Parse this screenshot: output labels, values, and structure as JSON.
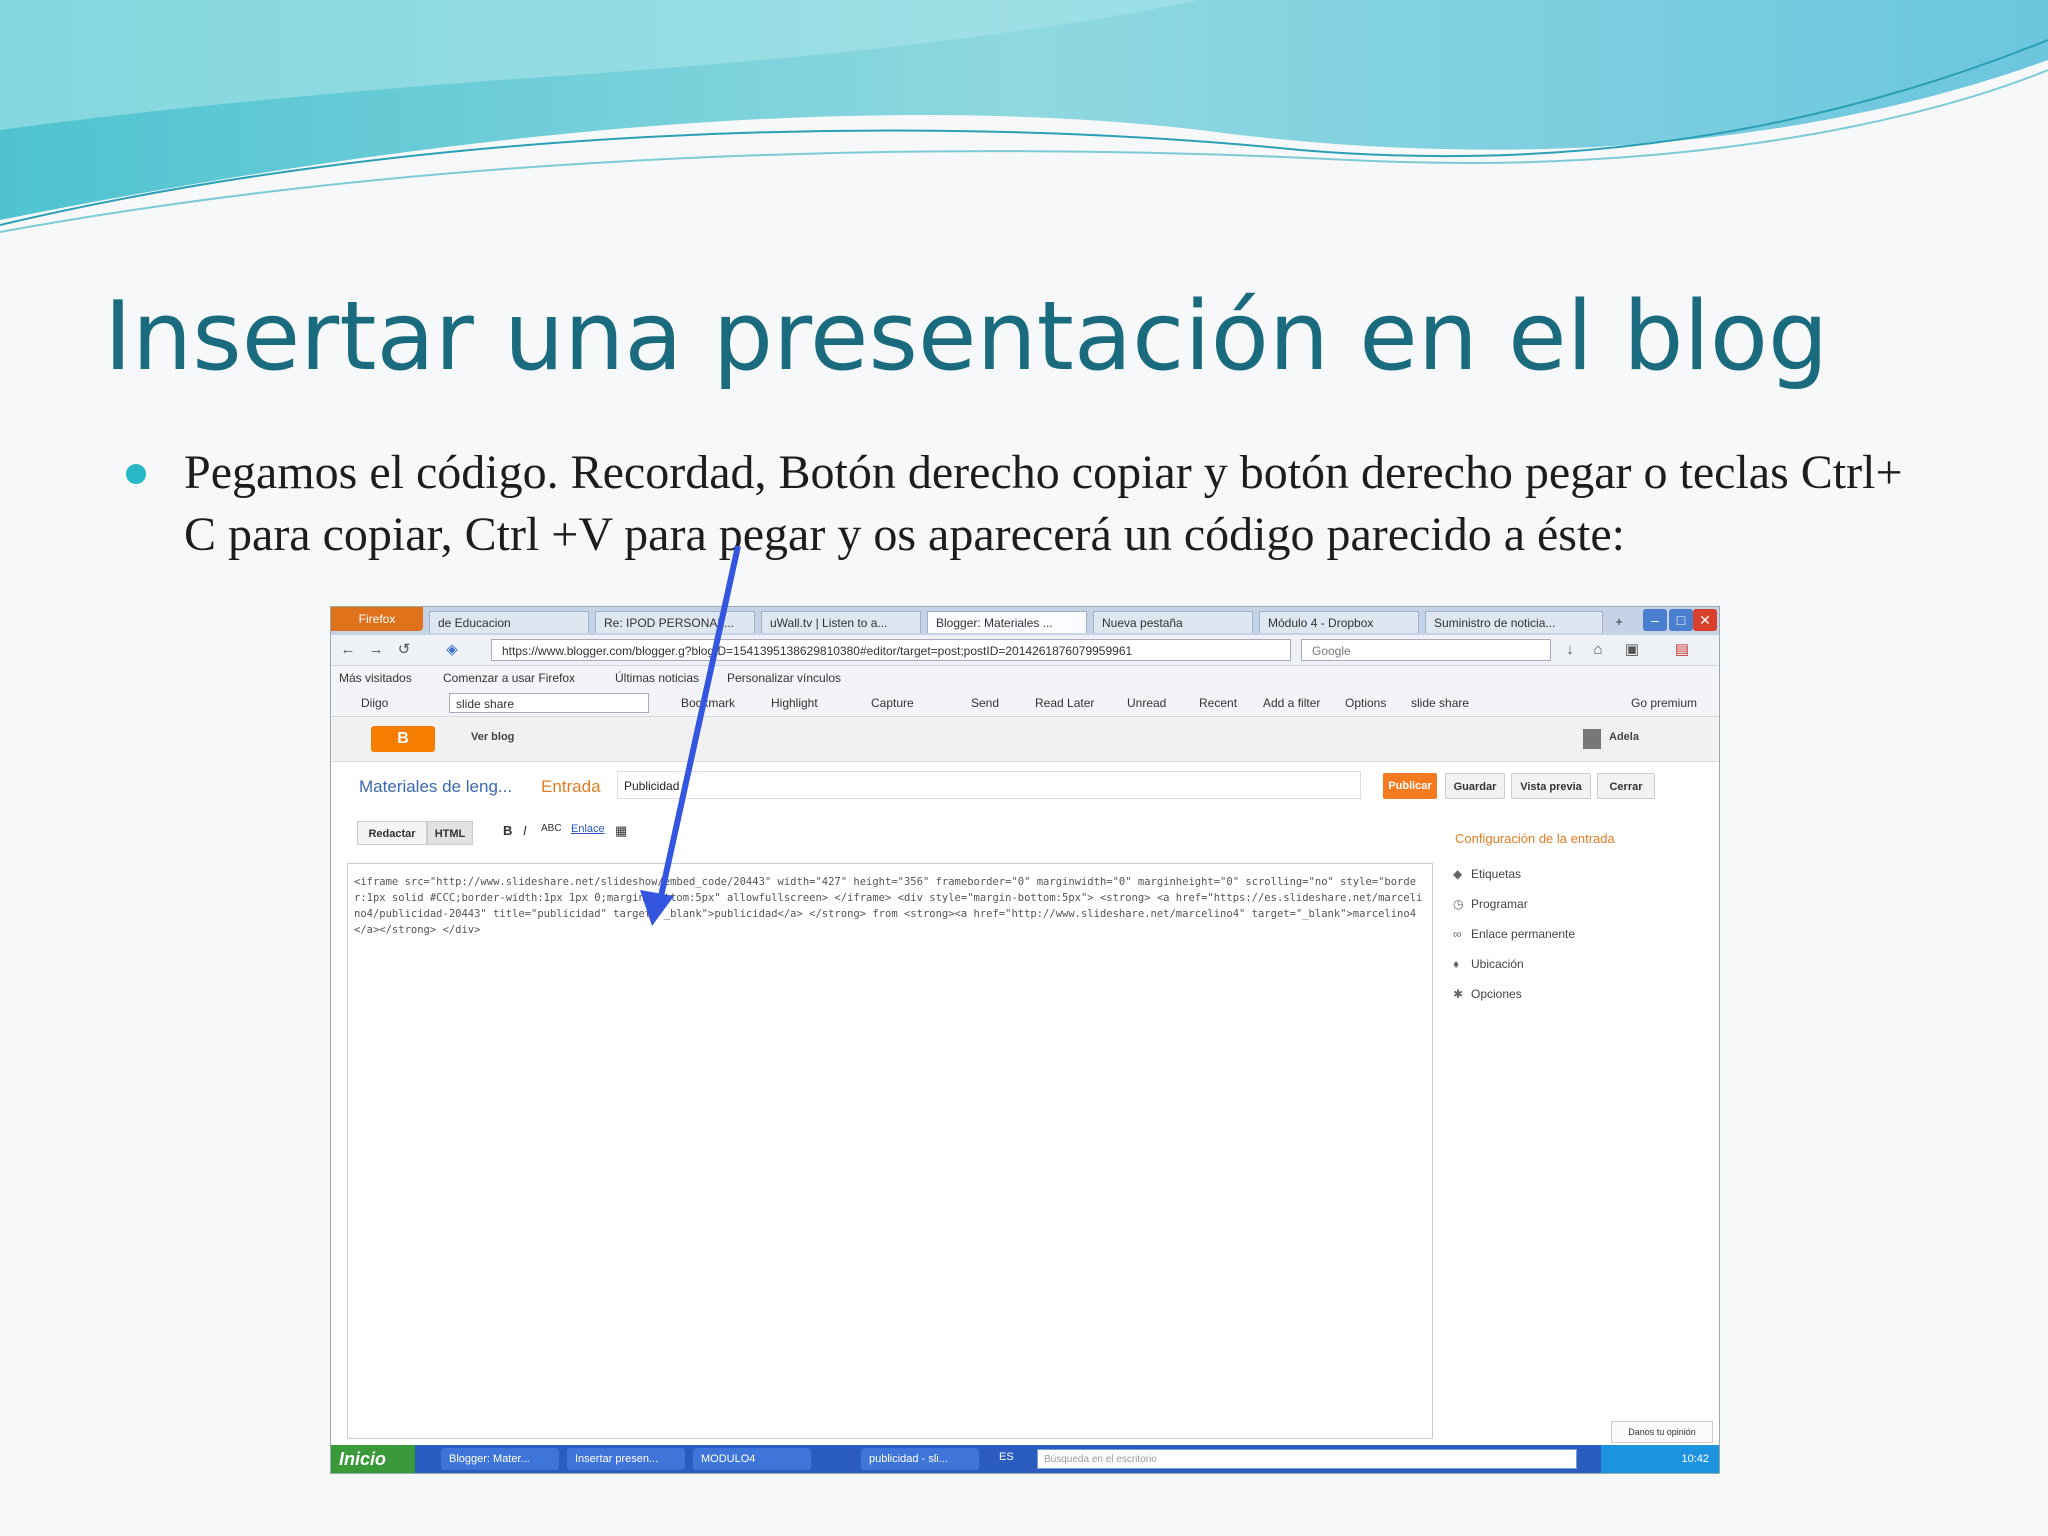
{
  "slide": {
    "title": "Insertar una presentación en el blog",
    "bullet": "Pegamos el código. Recordad, Botón derecho copiar y botón derecho pegar o teclas Ctrl+ C para copiar, Ctrl +V para pegar y os aparecerá un código parecido a éste:"
  },
  "browser": {
    "firefox_button": "Firefox",
    "tabs": [
      "de Educacion",
      "Re: IPOD PERSONAL...",
      "uWall.tv | Listen to a...",
      "Blogger: Materiales ...",
      "Nueva pestaña",
      "Módulo 4 - Dropbox",
      "Suministro de noticia..."
    ],
    "url": "https://www.blogger.com/blogger.g?blogID=1541395138629810380#editor/target=post;postID=2014261876079959961",
    "search_placeholder": "Google",
    "bookmarks": [
      "Más visitados",
      "Comenzar a usar Firefox",
      "Últimas noticias",
      "Personalizar vínculos"
    ],
    "toolbar": {
      "search_value": "slide share",
      "items": [
        "Diigo",
        "Bookmark",
        "Highlight",
        "Capture",
        "Send",
        "Read Later",
        "Unread",
        "Recent",
        "Add a filter",
        "Options",
        "slide share",
        "Go premium"
      ]
    }
  },
  "blogger": {
    "logo": "B",
    "ver_blog": "Ver blog",
    "user": "Adela",
    "blog_name": "Materiales de leng...",
    "entry_label": "Entrada",
    "post_title": "Publicidad",
    "buttons": {
      "publish": "Publicar",
      "save": "Guardar",
      "preview": "Vista previa",
      "close": "Cerrar"
    },
    "modes": {
      "compose": "Redactar",
      "html": "HTML"
    },
    "format_link": "Enlace",
    "code": "<iframe src=\"http://www.slideshare.net/slideshow/embed_code/20443\" width=\"427\" height=\"356\" frameborder=\"0\" marginwidth=\"0\" marginheight=\"0\" scrolling=\"no\" style=\"border:1px solid #CCC;border-width:1px 1px 0;margin-bottom:5px\" allowfullscreen> </iframe> <div style=\"margin-bottom:5px\"> <strong> <a href=\"https://es.slideshare.net/marcelino4/publicidad-20443\" title=\"publicidad\" target=\"_blank\">publicidad</a> </strong> from <strong><a href=\"http://www.slideshare.net/marcelino4\" target=\"_blank\">marcelino4</a></strong> </div>",
    "sidebar": {
      "heading": "Configuración de la entrada",
      "items": [
        "Etiquetas",
        "Programar",
        "Enlace permanente",
        "Ubicación",
        "Opciones"
      ]
    },
    "feedback": "Danos tu opinión"
  },
  "taskbar": {
    "start": "Inicio",
    "tasks": [
      "Blogger: Mater...",
      "Insertar presen...",
      "MODULO4",
      "publicidad - sli..."
    ],
    "lang": "ES",
    "search_placeholder": "Búsqueda en el escritorio",
    "clock": "10:42"
  },
  "colors": {
    "title": "#1a6b7d",
    "bullet": "#28b8c8",
    "blogger_orange": "#f47b20",
    "arrow": "#3355e0"
  }
}
